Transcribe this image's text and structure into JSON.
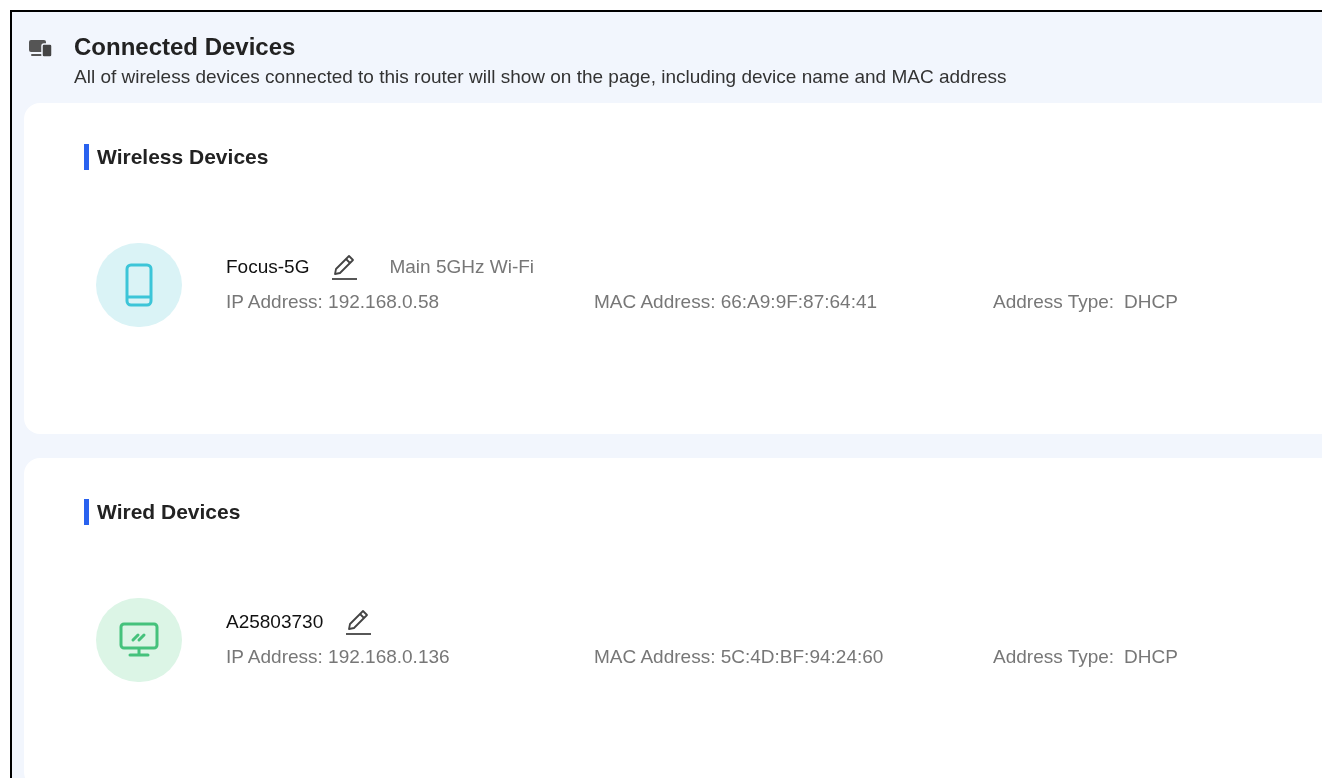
{
  "header": {
    "title": "Connected Devices",
    "subtitle": "All of wireless devices connected to this router will show on the page, including device name and MAC address"
  },
  "sections": [
    {
      "title": "Wireless Devices",
      "devices": [
        {
          "kind": "phone",
          "name": "Focus-5G",
          "network": "Main 5GHz Wi-Fi",
          "ip": "IP Address: 192.168.0.58",
          "mac": "MAC Address: 66:A9:9F:87:64:41",
          "address_type_label": "Address Type:",
          "address_type": "DHCP"
        }
      ]
    },
    {
      "title": "Wired Devices",
      "devices": [
        {
          "kind": "monitor",
          "name": "A25803730",
          "ip": "IP Address: 192.168.0.136",
          "mac": "MAC Address: 5C:4D:BF:94:24:60",
          "address_type_label": "Address Type:",
          "address_type": "DHCP"
        }
      ]
    }
  ]
}
